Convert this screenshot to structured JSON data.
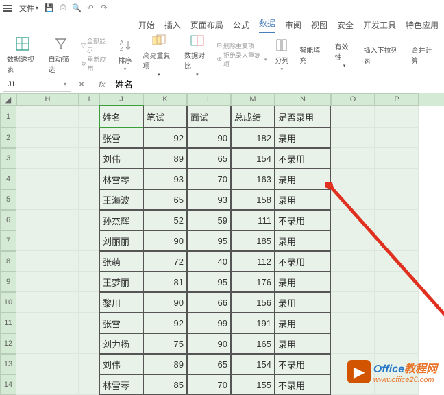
{
  "topmenu": {
    "file": "文件"
  },
  "tabs": [
    "开始",
    "插入",
    "页面布局",
    "公式",
    "数据",
    "审阅",
    "视图",
    "安全",
    "开发工具",
    "特色应用"
  ],
  "activeTab": 4,
  "ribbon": {
    "pivot": "数据透视表",
    "autofilter": "自动筛选",
    "showall": "全部显示",
    "reapply": "重新应用",
    "sort": "排序",
    "highlight": "高亮重复项",
    "datacompare": "数据对比",
    "removedup": "删除重复项",
    "rejectdup": "拒绝录入重复项",
    "splitcol": "分列",
    "smartfill": "智能填充",
    "validation": "有效性",
    "insertdd": "插入下拉列表",
    "consolidate": "合并计算"
  },
  "namebox": "J1",
  "formula": "姓名",
  "cols": [
    "H",
    "I",
    "J",
    "K",
    "L",
    "M",
    "N",
    "O",
    "P"
  ],
  "rowNums": [
    1,
    2,
    3,
    4,
    5,
    6,
    7,
    8,
    9,
    10,
    11,
    12,
    13,
    14
  ],
  "chart_data": {
    "type": "table",
    "title": "",
    "headers": [
      "姓名",
      "笔试",
      "面试",
      "总成绩",
      "是否录用"
    ],
    "rows": [
      [
        "张雪",
        92,
        90,
        182,
        "录用"
      ],
      [
        "刘伟",
        89,
        65,
        154,
        "不录用"
      ],
      [
        "林雪琴",
        93,
        70,
        163,
        "录用"
      ],
      [
        "王海波",
        65,
        93,
        158,
        "录用"
      ],
      [
        "孙杰辉",
        52,
        59,
        111,
        "不录用"
      ],
      [
        "刘丽丽",
        90,
        95,
        185,
        "录用"
      ],
      [
        "张萌",
        72,
        40,
        112,
        "不录用"
      ],
      [
        "王梦丽",
        81,
        95,
        176,
        "录用"
      ],
      [
        "黎川",
        90,
        66,
        156,
        "录用"
      ],
      [
        "张雪",
        92,
        99,
        191,
        "录用"
      ],
      [
        "刘力扬",
        75,
        90,
        165,
        "录用"
      ],
      [
        "刘伟",
        89,
        65,
        154,
        "不录用"
      ],
      [
        "林雪琴",
        85,
        70,
        155,
        "不录用"
      ]
    ]
  },
  "watermark": {
    "brand1a": "Office",
    "brand1b": "教程网",
    "url": "www.office26.com"
  }
}
